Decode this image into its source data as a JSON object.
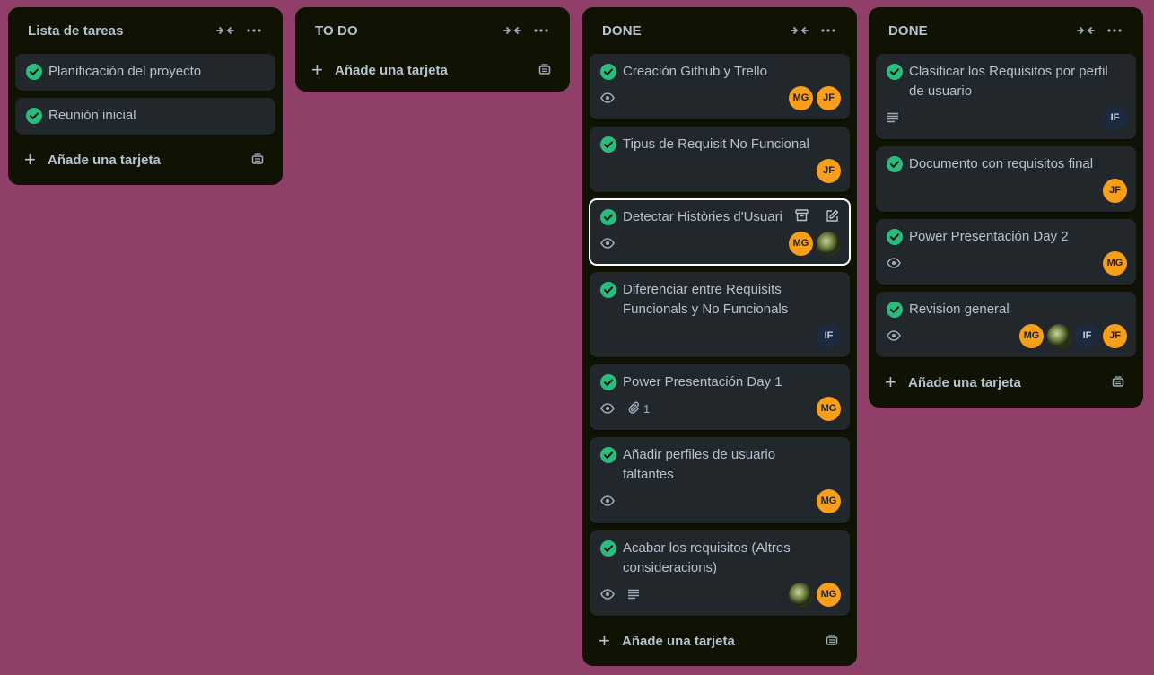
{
  "colors": {
    "board_bg": "#8f3f68",
    "list_bg": "#101204",
    "card_bg": "#22272b",
    "check_green": "#2abb7f",
    "avatar_orange": "#f79e1b",
    "avatar_navy": "#1c2b41"
  },
  "lists": [
    {
      "title": "Lista de tareas",
      "cards": [
        {
          "title": "Planificación del proyecto"
        },
        {
          "title": "Reunión inicial"
        }
      ],
      "add_label": "Añade una tarjeta"
    },
    {
      "title": "TO DO",
      "cards": [],
      "add_label": "Añade una tarjeta"
    },
    {
      "title": "DONE",
      "cards": [
        {
          "title": "Creación Github y Trello",
          "members": [
            "MG",
            "JF"
          ]
        },
        {
          "title": "Tipus de Requisit No Funcional",
          "members": [
            "JF"
          ]
        },
        {
          "title": "Detectar Històries d'Usuari",
          "members": [
            "MG"
          ]
        },
        {
          "title": "Diferenciar entre Requisits Funcionals y No Funcionals",
          "members": [
            "IF"
          ]
        },
        {
          "title": "Power Presentación Day 1",
          "attachments": "1",
          "members": [
            "MG"
          ]
        },
        {
          "title": "Añadir perfiles de usuario faltantes",
          "members": [
            "MG"
          ]
        },
        {
          "title": "Acabar los requisitos (Altres consideracions)",
          "members": [
            "MG"
          ]
        }
      ],
      "add_label": "Añade una tarjeta"
    },
    {
      "title": "DONE",
      "cards": [
        {
          "title": "Clasificar los Requisitos por perfil de usuario",
          "members": [
            "IF"
          ]
        },
        {
          "title": "Documento con requisitos final",
          "members": [
            "JF"
          ]
        },
        {
          "title": "Power Presentación Day 2",
          "members": [
            "MG"
          ]
        },
        {
          "title": "Revision general",
          "members": [
            "MG",
            "IF",
            "JF"
          ]
        }
      ],
      "add_label": "Añade una tarjeta"
    }
  ]
}
